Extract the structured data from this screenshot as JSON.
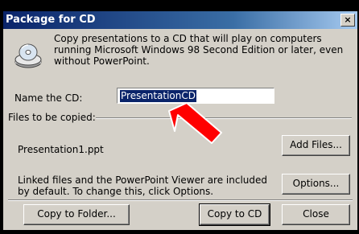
{
  "window": {
    "title": "Package for CD",
    "close_symbol": "×"
  },
  "description": "Copy presentations to a CD that will play on computers running Microsoft Windows 98 Second Edition or later, even without PowerPoint.",
  "name_cd": {
    "label": "Name the CD:",
    "value": "PresentationCD"
  },
  "files": {
    "section_label": "Files to be copied:",
    "items": [
      "Presentation1.ppt"
    ],
    "add_button": "Add Files..."
  },
  "linked": {
    "text": "Linked files and the PowerPoint Viewer are included by default. To change this, click Options.",
    "options_button": "Options..."
  },
  "footer": {
    "copy_folder_button": "Copy to Folder...",
    "copy_cd_button": "Copy to CD",
    "close_button": "Close"
  },
  "icons": {
    "cd": "cd-drive-icon",
    "pointer": "red-arrow-icon"
  },
  "colors": {
    "titlebar_start": "#0a246a",
    "titlebar_end": "#a6caf0",
    "dialog_face": "#d4d0c8",
    "arrow": "#ff0000"
  }
}
